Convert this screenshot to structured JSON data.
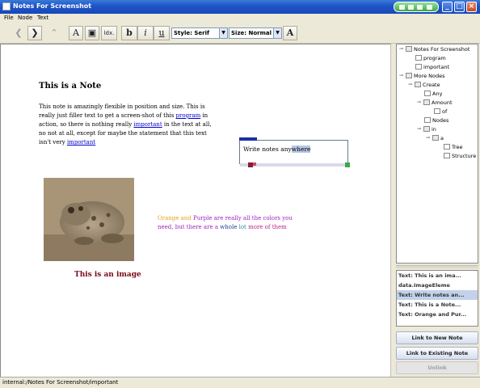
{
  "window": {
    "title": "Notes For Screenshot"
  },
  "menu": [
    "File",
    "Node",
    "Text"
  ],
  "toolbar": {
    "style_label": "Style: Serif",
    "size_label": "Size: Normal",
    "ldx_label": "ldx.",
    "bold_label": "b",
    "italic_label": "i",
    "underline_label": "u",
    "textcolor_label": "A"
  },
  "canvas": {
    "note_title": "This is a Note",
    "note_body": {
      "p1": "This note is amazingly flexible in position and size.  This is really just filler text to get a screen-shot of this ",
      "link1": "program",
      "p2": " in action, so there is nothing really ",
      "link2": "important",
      "p3": " in the text at all, no not at all, except for maybe the statement that this text isn't very ",
      "link3": "important"
    },
    "edit_box": {
      "text_before": "Write notes any",
      "text_selected": "where"
    },
    "image_caption": "This is an image",
    "colors_text": {
      "w1": "Orange",
      "w2": "and",
      "w3": "Purple",
      "w4": "are really all the colors you need, but there are a",
      "w5": "whole",
      "w6": "lot",
      "w7": "more of them"
    },
    "colors": {
      "orange": "#e8a020",
      "purple": "#a020c0",
      "blue": "#1a3aa0",
      "teal": "#2090a0",
      "magenta": "#c02080"
    }
  },
  "tree": {
    "root": "Notes For Screenshot",
    "items": [
      "program",
      "important",
      "More Nodes",
      "Create",
      "Any",
      "Amount",
      "of",
      "Nodes",
      "in",
      "a",
      "Tree",
      "Structure"
    ]
  },
  "list": {
    "items": [
      "Text: This is an ima...",
      "data.ImageEleme",
      "Text: Write notes an...",
      "Text: This is a Note...",
      "Text: Orange and Pur..."
    ],
    "selected_index": 2
  },
  "buttons": {
    "link_new": "Link to New Note",
    "link_existing": "Link to Existing Note",
    "unlink": "Unlink"
  },
  "status": "internal:/Notes For Screenshot/important"
}
